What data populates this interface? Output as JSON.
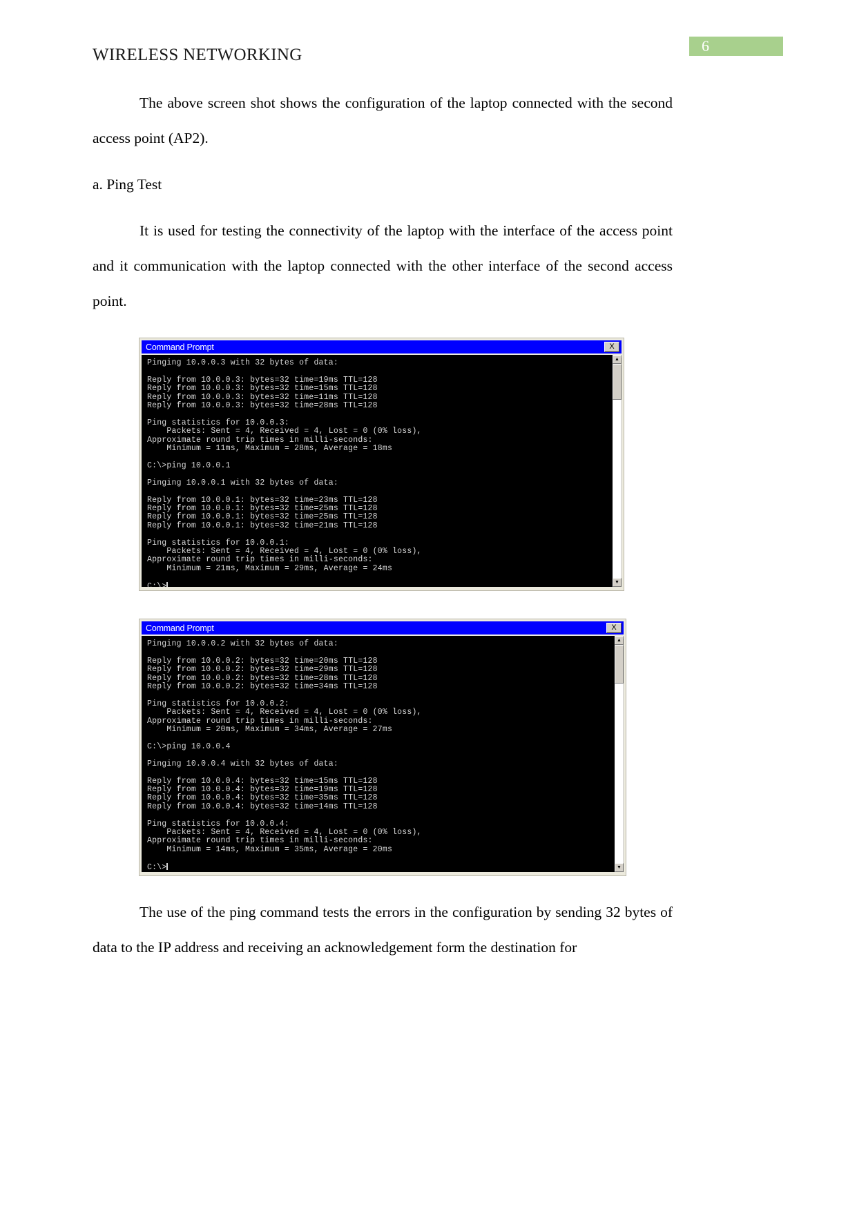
{
  "header": {
    "title": "WIRELESS NETWORKING",
    "page_number": "6",
    "badge_color": "#a8d08d"
  },
  "paragraphs": {
    "p1": "The above screen shot shows the configuration of the laptop connected with the second access point (AP2).",
    "heading_a": "a. Ping Test",
    "p2": "It is used for testing the connectivity of the laptop with the interface of the access point and it communication with the laptop connected with the other interface of the second access point.",
    "p3": "The use of the ping command tests the errors in the configuration by sending 32 bytes of data to the IP address and receiving an acknowledgement form the destination for"
  },
  "windows": [
    {
      "title": "Command Prompt",
      "close_label": "X",
      "scroll_up_glyph": "▲",
      "scroll_down_glyph": "▼",
      "lines": [
        "Pinging 10.0.0.3 with 32 bytes of data:",
        "",
        "Reply from 10.0.0.3: bytes=32 time=19ms TTL=128",
        "Reply from 10.0.0.3: bytes=32 time=15ms TTL=128",
        "Reply from 10.0.0.3: bytes=32 time=11ms TTL=128",
        "Reply from 10.0.0.3: bytes=32 time=28ms TTL=128",
        "",
        "Ping statistics for 10.0.0.3:",
        "    Packets: Sent = 4, Received = 4, Lost = 0 (0% loss),",
        "Approximate round trip times in milli-seconds:",
        "    Minimum = 11ms, Maximum = 28ms, Average = 18ms",
        "",
        "C:\\>ping 10.0.0.1",
        "",
        "Pinging 10.0.0.1 with 32 bytes of data:",
        "",
        "Reply from 10.0.0.1: bytes=32 time=23ms TTL=128",
        "Reply from 10.0.0.1: bytes=32 time=25ms TTL=128",
        "Reply from 10.0.0.1: bytes=32 time=25ms TTL=128",
        "Reply from 10.0.0.1: bytes=32 time=21ms TTL=128",
        "",
        "Ping statistics for 10.0.0.1:",
        "    Packets: Sent = 4, Received = 4, Lost = 0 (0% loss),",
        "Approximate round trip times in milli-seconds:",
        "    Minimum = 21ms, Maximum = 29ms, Average = 24ms",
        "",
        "C:\\>"
      ]
    },
    {
      "title": "Command Prompt",
      "close_label": "X",
      "scroll_up_glyph": "▲",
      "scroll_down_glyph": "▼",
      "lines": [
        "Pinging 10.0.0.2 with 32 bytes of data:",
        "",
        "Reply from 10.0.0.2: bytes=32 time=20ms TTL=128",
        "Reply from 10.0.0.2: bytes=32 time=29ms TTL=128",
        "Reply from 10.0.0.2: bytes=32 time=28ms TTL=128",
        "Reply from 10.0.0.2: bytes=32 time=34ms TTL=128",
        "",
        "Ping statistics for 10.0.0.2:",
        "    Packets: Sent = 4, Received = 4, Lost = 0 (0% loss),",
        "Approximate round trip times in milli-seconds:",
        "    Minimum = 20ms, Maximum = 34ms, Average = 27ms",
        "",
        "C:\\>ping 10.0.0.4",
        "",
        "Pinging 10.0.0.4 with 32 bytes of data:",
        "",
        "Reply from 10.0.0.4: bytes=32 time=15ms TTL=128",
        "Reply from 10.0.0.4: bytes=32 time=19ms TTL=128",
        "Reply from 10.0.0.4: bytes=32 time=35ms TTL=128",
        "Reply from 10.0.0.4: bytes=32 time=14ms TTL=128",
        "",
        "Ping statistics for 10.0.0.4:",
        "    Packets: Sent = 4, Received = 4, Lost = 0 (0% loss),",
        "Approximate round trip times in milli-seconds:",
        "    Minimum = 14ms, Maximum = 35ms, Average = 20ms",
        "",
        "C:\\>"
      ]
    }
  ]
}
